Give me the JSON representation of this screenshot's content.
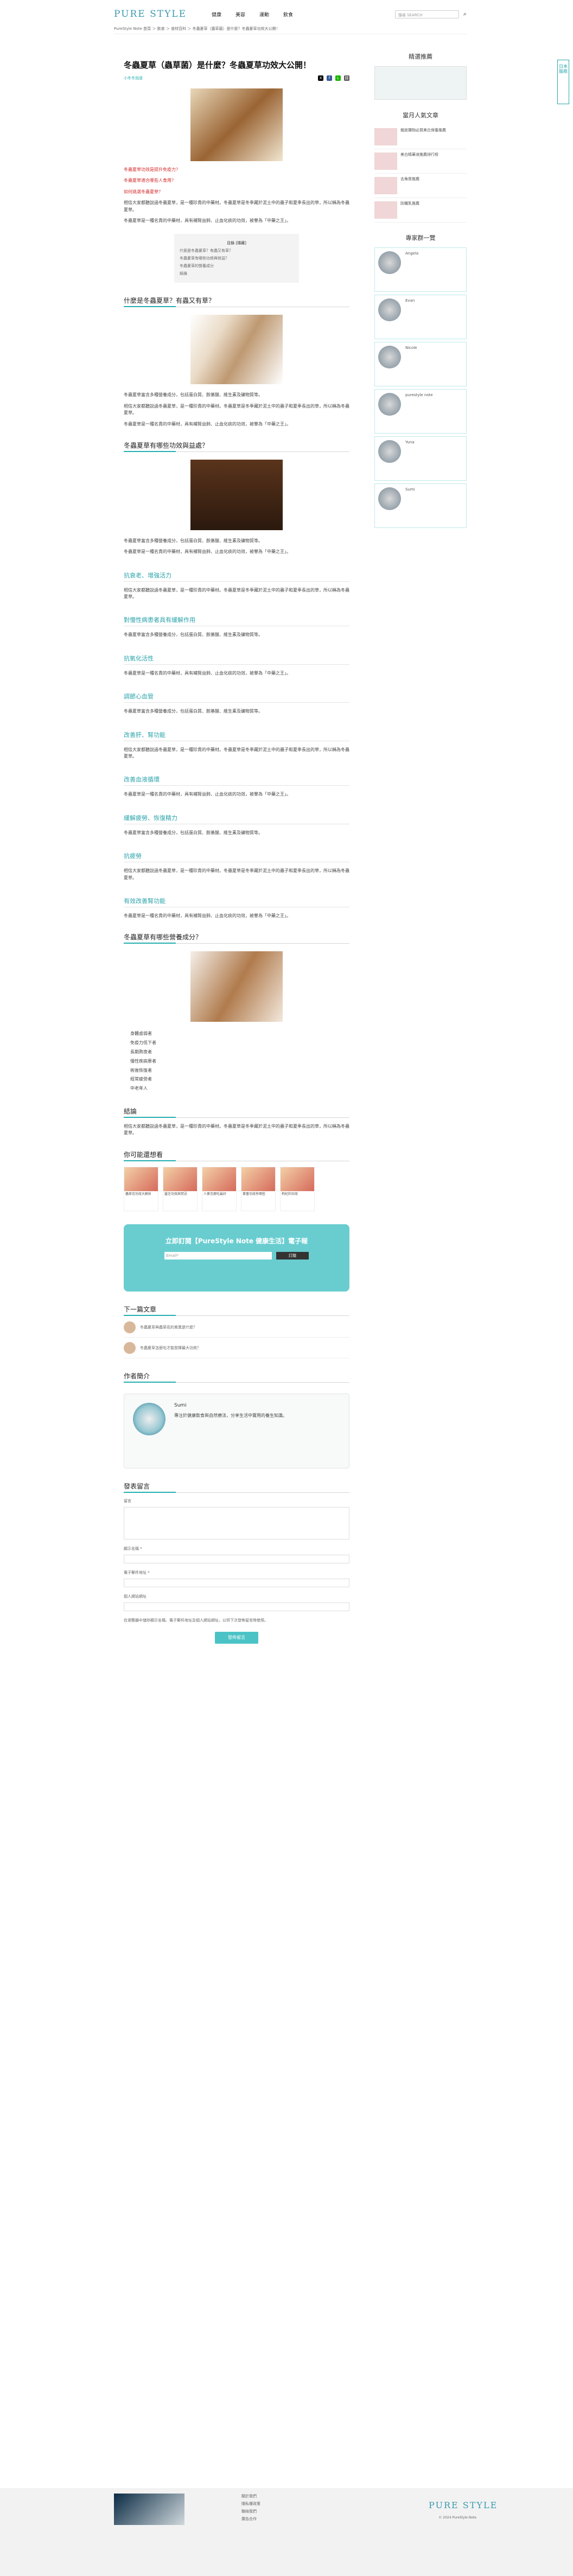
{
  "header": {
    "logo": "PURE STYLE",
    "nav": [
      "健康",
      "美容",
      "運動",
      "飲食"
    ],
    "search_placeholder": "搜尋 SEARCH",
    "breadcrumb": "PureStyle Note 首頁 ＞ 飲食 ＞ 食材百科 ＞ 冬蟲夏草（蟲草菌）是什麼？冬蟲夏草功效大公開！"
  },
  "article": {
    "title": "冬蟲夏草（蟲草菌）是什麼？冬蟲夏草功效大公開！",
    "author": "小冬冬說道",
    "intro_red": [
      "冬蟲夏草功效是提升免疫力？",
      "冬蟲夏草適合哪些人食用？",
      "如何挑選冬蟲夏草？"
    ],
    "toc_title": "目錄 [隱藏]",
    "toc": [
      "什麼是冬蟲夏草？有蟲又有草？",
      "冬蟲夏草有哪些功效與效益？",
      "冬蟲夏草的營養成分",
      "結論"
    ],
    "sections": [
      "什麼是冬蟲夏草？有蟲又有草？",
      "冬蟲夏草有哪些功效與益處？",
      "抗衰老、增強活力",
      "對慢性病患者具有緩解作用",
      "抗氧化活性",
      "調節心血管",
      "改善肝、腎功能",
      "改善血液循環",
      "緩解疲勞、恢復精力",
      "抗疲勞",
      "有效改善腎功能",
      "冬蟲夏草有哪些營養成分？",
      "結論"
    ],
    "paragraphs": [
      "相信大家都聽說過冬蟲夏草，是一種珍貴的中藥材。冬蟲夏草是冬季藏於泥土中的蟲子和夏季長出的草，所以稱為冬蟲夏草。",
      "冬蟲夏草是一種名貴的中藥材，具有補腎益肺、止血化痰的功效，被譽為「中藥之王」。",
      "冬蟲夏草富含多種營養成分，包括蛋白質、胺基酸、維生素及礦物質等。"
    ],
    "list": [
      "身體虛弱者",
      "免疫力低下者",
      "長期熬夜者",
      "慢性疾病患者",
      "術後恢復者",
      "經常疲勞者",
      "中老年人"
    ],
    "related_title": "你可能還想看",
    "related": [
      "蟲草花功效大解析",
      "靈芝功效與禁忌",
      "人蔘怎麼吃最好",
      "黃耆功效有哪些",
      "枸杞的功效"
    ],
    "subscribe_title": "立即訂閱【PureStyle Note 健康生活】電子報",
    "subscribe_email": "Email*",
    "subscribe_btn": "訂閱",
    "next_title": "下一篇文章",
    "next": [
      "冬蟲夏草與蟲草花的差異是什麼？",
      "冬蟲夏草怎麼吃才能發揮最大功效？"
    ],
    "author_box_title": "作者簡介",
    "author_name": "Sumi",
    "author_bio": "專注於健康飲食與自然療法，分享生活中實用的養生知識。"
  },
  "comment": {
    "title": "發表留言",
    "fields": [
      "留言",
      "顯示名稱 *",
      "電子郵件地址 *",
      "個人網站網址"
    ],
    "agree": "在瀏覽器中儲存顯示名稱、電子郵件地址及個人網站網址，以供下次發佈留言時使用。",
    "submit": "發佈留言"
  },
  "sidebar": {
    "ad_title": "精選推薦",
    "hot_title": "當月人氣文章",
    "hot": [
      "蝦皮購物必買美白保養推薦",
      "美白精華液推薦排行榜",
      "去角質推薦",
      "防曬乳推薦"
    ],
    "expert_title": "專家群一覽",
    "experts": [
      "Angela",
      "Evan",
      "Nicole",
      "purestyle note",
      "Yuna",
      "Sumi"
    ]
  },
  "footer": {
    "logo": "PURE STYLE",
    "links": [
      "關於我們",
      "隱私權政策",
      "聯絡我們",
      "廣告合作"
    ],
    "copyright": "© 2024 PureStyle Note"
  },
  "right_button": "日本服務"
}
